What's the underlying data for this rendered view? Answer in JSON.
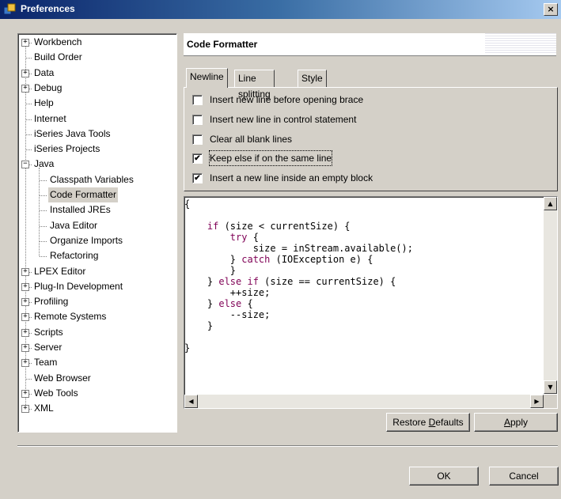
{
  "window": {
    "title": "Preferences",
    "close_glyph": "×"
  },
  "tree": {
    "items": [
      {
        "label": "Workbench",
        "expander": "+"
      },
      {
        "label": "Build Order",
        "expander": ""
      },
      {
        "label": "Data",
        "expander": "+"
      },
      {
        "label": "Debug",
        "expander": "+"
      },
      {
        "label": "Help",
        "expander": ""
      },
      {
        "label": "Internet",
        "expander": ""
      },
      {
        "label": "iSeries Java Tools",
        "expander": ""
      },
      {
        "label": "iSeries Projects",
        "expander": ""
      },
      {
        "label": "Java",
        "expander": "−"
      },
      {
        "label": "Classpath Variables",
        "expander": ""
      },
      {
        "label": "Code Formatter",
        "expander": ""
      },
      {
        "label": "Installed JREs",
        "expander": ""
      },
      {
        "label": "Java Editor",
        "expander": ""
      },
      {
        "label": "Organize Imports",
        "expander": ""
      },
      {
        "label": "Refactoring",
        "expander": ""
      },
      {
        "label": "LPEX Editor",
        "expander": "+"
      },
      {
        "label": "Plug-In Development",
        "expander": "+"
      },
      {
        "label": "Profiling",
        "expander": "+"
      },
      {
        "label": "Remote Systems",
        "expander": "+"
      },
      {
        "label": "Scripts",
        "expander": "+"
      },
      {
        "label": "Server",
        "expander": "+"
      },
      {
        "label": "Team",
        "expander": "+"
      },
      {
        "label": "Web Browser",
        "expander": ""
      },
      {
        "label": "Web Tools",
        "expander": "+"
      },
      {
        "label": "XML",
        "expander": "+"
      }
    ],
    "selected": "Code Formatter"
  },
  "page": {
    "title": "Code Formatter"
  },
  "tabs": [
    {
      "label": "Newline",
      "active": true
    },
    {
      "label": "Line splitting",
      "active": false
    },
    {
      "label": "Style",
      "active": false
    }
  ],
  "options": [
    {
      "label": "Insert new line before opening brace",
      "checked": false
    },
    {
      "label": "Insert new line in control statement",
      "checked": false
    },
    {
      "label": "Clear all blank lines",
      "checked": false
    },
    {
      "label": "Keep else if on the same line",
      "checked": true
    },
    {
      "label": "Insert a new line inside an empty block",
      "checked": true
    }
  ],
  "check_glyph": "✔",
  "preview": {
    "lines": [
      "{",
      "",
      "    if (size < currentSize) {",
      "        try {",
      "            size = inStream.available();",
      "        } catch (IOException e) {",
      "        }",
      "    } else if (size == currentSize) {",
      "        ++size;",
      "    } else {",
      "        --size;",
      "    }",
      "",
      "}"
    ]
  },
  "scroll_glyphs": {
    "up": "▲",
    "down": "▼",
    "left": "◀",
    "right": "▶"
  },
  "buttons": {
    "restore_defaults": "Restore Defaults",
    "apply": "Apply",
    "ok": "OK",
    "cancel": "Cancel"
  }
}
